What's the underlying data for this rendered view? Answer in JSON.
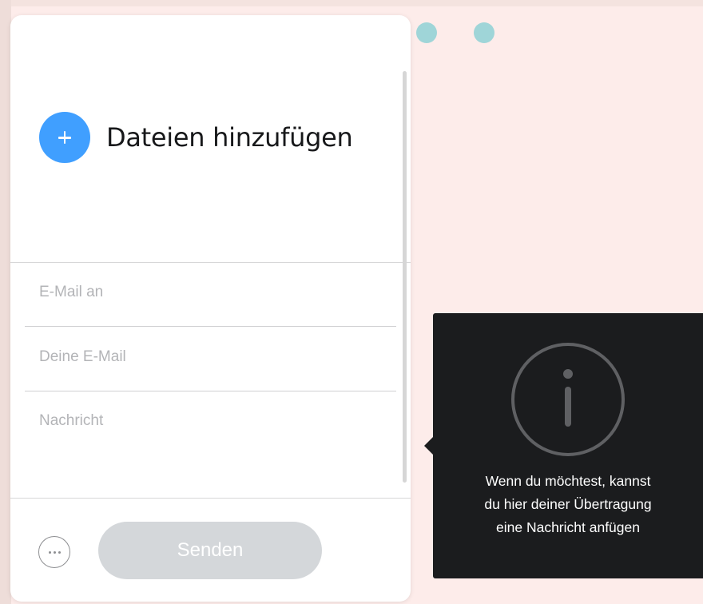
{
  "background": {
    "color": "#fdecea",
    "dot_color": "#9fd5d8"
  },
  "upload_panel": {
    "add_files_label": "Dateien hinzufügen",
    "add_files_icon": "plus-icon",
    "accent_color": "#409fff",
    "fields": {
      "email_to_placeholder": "E-Mail an",
      "your_email_placeholder": "Deine E-Mail",
      "message_placeholder": "Nachricht"
    },
    "more_options_icon": "ellipsis-icon",
    "send_label": "Senden",
    "send_enabled": false
  },
  "tooltip": {
    "icon": "info-icon",
    "lines": [
      "Wenn du möchtest, kannst",
      "du hier deiner Übertragung",
      "eine Nachricht anfügen"
    ]
  }
}
